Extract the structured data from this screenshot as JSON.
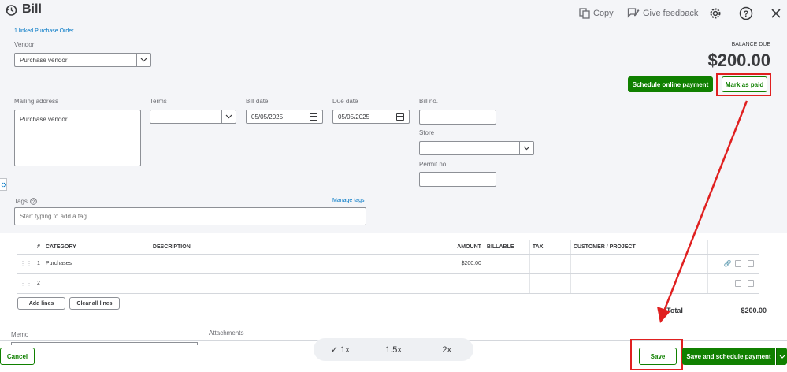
{
  "header": {
    "title": "Bill",
    "copy_label": "Copy",
    "feedback_label": "Give feedback"
  },
  "linked_po": "1 linked Purchase Order",
  "vendor": {
    "label": "Vendor",
    "value": "Purchase vendor"
  },
  "balance": {
    "label": "BALANCE DUE",
    "amount": "$200.00"
  },
  "actions": {
    "schedule_online": "Schedule online payment",
    "mark_paid": "Mark as paid"
  },
  "mailing": {
    "label": "Mailing address",
    "value": "Purchase vendor"
  },
  "terms": {
    "label": "Terms",
    "value": ""
  },
  "bill_date": {
    "label": "Bill date",
    "value": "05/05/2025"
  },
  "due_date": {
    "label": "Due date",
    "value": "05/05/2025"
  },
  "bill_no": {
    "label": "Bill no.",
    "value": ""
  },
  "store": {
    "label": "Store",
    "value": ""
  },
  "permit": {
    "label": "Permit no.",
    "value": ""
  },
  "tags": {
    "label": "Tags",
    "manage": "Manage tags",
    "placeholder": "Start typing to add a tag"
  },
  "table": {
    "headers": [
      "#",
      "CATEGORY",
      "DESCRIPTION",
      "AMOUNT",
      "BILLABLE",
      "TAX",
      "CUSTOMER / PROJECT"
    ],
    "rows": [
      {
        "num": "1",
        "category": "Purchases",
        "description": "",
        "amount": "$200.00"
      },
      {
        "num": "2",
        "category": "",
        "description": "",
        "amount": ""
      }
    ]
  },
  "add_lines": "Add lines",
  "clear_lines": "Clear all lines",
  "total": {
    "label": "Total",
    "value": "$200.00"
  },
  "memo_label": "Memo",
  "attachments_label": "Attachments",
  "zoom": {
    "options": [
      "1x",
      "1.5x",
      "2x"
    ],
    "selected": "1x"
  },
  "footer": {
    "cancel": "Cancel",
    "save": "Save",
    "save_schedule": "Save and schedule payment"
  },
  "colors": {
    "brand_green": "#108000",
    "link_blue": "#0077c5",
    "annotation_red": "#e02020"
  }
}
